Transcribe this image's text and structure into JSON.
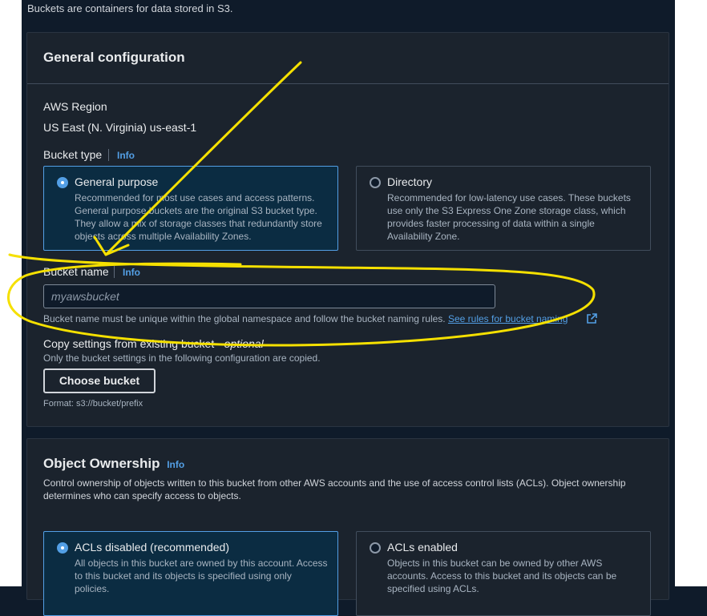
{
  "intro": "Buckets are containers for data stored in S3.",
  "colors": {
    "accent": "#539fe5",
    "annotation": "#f5e000",
    "panel": "#1b232d"
  },
  "general": {
    "title": "General configuration",
    "region_label": "AWS Region",
    "region_value": "US East (N. Virginia) us-east-1",
    "bucket_type_label": "Bucket type",
    "info": "Info",
    "types": [
      {
        "title": "General purpose",
        "desc": "Recommended for most use cases and access patterns. General purpose buckets are the original S3 bucket type. They allow a mix of storage classes that redundantly store objects across multiple Availability Zones.",
        "selected": true
      },
      {
        "title": "Directory",
        "desc": "Recommended for low-latency use cases. These buckets use only the S3 Express One Zone storage class, which provides faster processing of data within a single Availability Zone.",
        "selected": false
      }
    ],
    "bucket_name_label": "Bucket name",
    "bucket_name_placeholder": "myawsbucket",
    "bucket_name_hint": "Bucket name must be unique within the global namespace and follow the bucket naming rules.",
    "rules_link": "See rules for bucket naming",
    "copy_label": "Copy settings from existing bucket - ",
    "copy_optional": "optional",
    "copy_hint": "Only the bucket settings in the following configuration are copied.",
    "choose_button": "Choose bucket",
    "format_hint": "Format: s3://bucket/prefix"
  },
  "ownership": {
    "title": "Object Ownership",
    "info": "Info",
    "desc": "Control ownership of objects written to this bucket from other AWS accounts and the use of access control lists (ACLs). Object ownership determines who can specify access to objects.",
    "options": [
      {
        "title": "ACLs disabled (recommended)",
        "desc": "All objects in this bucket are owned by this account. Access to this bucket and its objects is specified using only policies.",
        "selected": true
      },
      {
        "title": "ACLs enabled",
        "desc": "Objects in this bucket can be owned by other AWS accounts. Access to this bucket and its objects can be specified using ACLs.",
        "selected": false
      }
    ]
  }
}
